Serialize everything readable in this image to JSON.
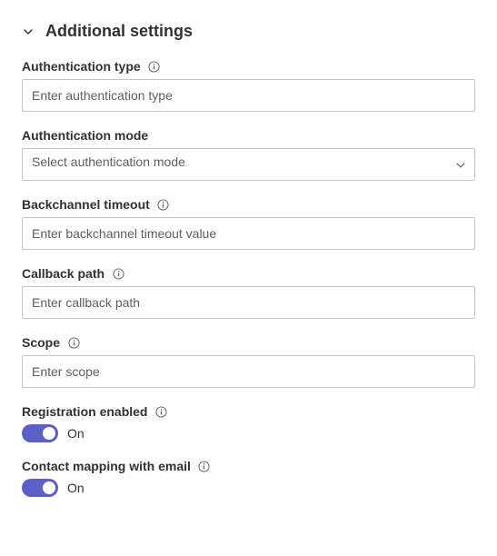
{
  "header": {
    "title": "Additional settings"
  },
  "fields": {
    "auth_type": {
      "label": "Authentication type",
      "placeholder": "Enter authentication type"
    },
    "auth_mode": {
      "label": "Authentication mode",
      "placeholder": "Select authentication mode"
    },
    "backchannel_timeout": {
      "label": "Backchannel timeout",
      "placeholder": "Enter backchannel timeout value"
    },
    "callback_path": {
      "label": "Callback path",
      "placeholder": "Enter callback path"
    },
    "scope": {
      "label": "Scope",
      "placeholder": "Enter scope"
    },
    "registration_enabled": {
      "label": "Registration enabled",
      "state_label": "On",
      "on": true
    },
    "contact_mapping": {
      "label": "Contact mapping with email",
      "state_label": "On",
      "on": true
    }
  }
}
